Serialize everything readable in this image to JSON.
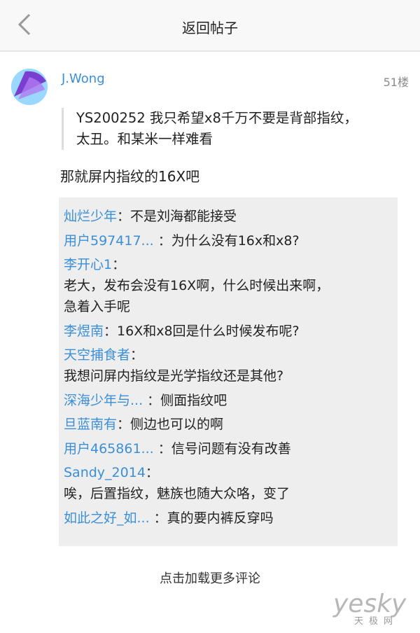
{
  "header": {
    "title": "返回帖子",
    "back_icon": "chevron-left-icon"
  },
  "post": {
    "username": "J.Wong",
    "floor": "51楼",
    "quote_line1": "YS200252  我只希望x8千万不要是背部指纹，",
    "quote_line2": "太丑。和某米一样难看",
    "reply": "那就屏内指纹的16X吧"
  },
  "comments": [
    {
      "name": "灿烂少年",
      "sep": "：",
      "text": "不是刘海都能接受"
    },
    {
      "name": "用户597417...",
      "sep": " ：",
      "text": "为什么没有16x和x8?"
    },
    {
      "name": "李开心1",
      "sep": "：",
      "text": "",
      "continuation": [
        "老大，发布会没有16X啊，什么时候出来啊，",
        "急着入手呢"
      ]
    },
    {
      "name": "李煜南",
      "sep": "：",
      "text": "16X和x8回是什么时候发布呢?"
    },
    {
      "name": "天空捕食者",
      "sep": "：",
      "text": "",
      "continuation": [
        "我想问屏内指纹是光学指纹还是其他?"
      ]
    },
    {
      "name": "深海少年与...",
      "sep": " ：",
      "text": "侧面指纹吧"
    },
    {
      "name": "旦蓝南有",
      "sep": "：",
      "text": "侧边也可以的啊"
    },
    {
      "name": "用户465861...",
      "sep": " ：",
      "text": "信号问题有没有改善"
    },
    {
      "name": "Sandy_2014",
      "sep": "：",
      "text": "",
      "continuation": [
        "唉，后置指纹，魅族也随大众咯，变了"
      ]
    },
    {
      "name": "如此之好_如...",
      "sep": " ：",
      "text": "真的要内裤反穿吗"
    }
  ],
  "load_more": "点击加载更多评论",
  "watermark": {
    "main": "yesky",
    "sub": "天极网"
  },
  "colors": {
    "name_blue": "#3b8fd6",
    "panel_gray": "#eeeeee"
  }
}
